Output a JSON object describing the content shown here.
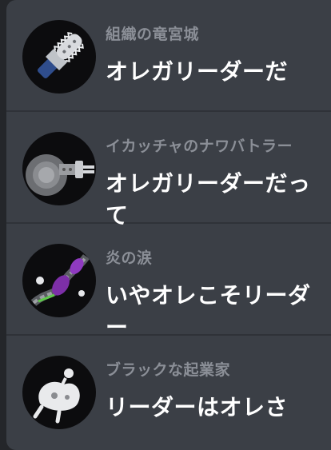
{
  "entries": [
    {
      "team": "組織の竜宮城",
      "title": "オレガリーダーだ",
      "icon": "chainsaw-icon"
    },
    {
      "team": "イカッチャのナワバトラー",
      "title": "オレガリーダーだって",
      "icon": "hand-drill-icon"
    },
    {
      "team": "炎の涙",
      "title": "いやオレこそリーダー",
      "icon": "purple-chain-icon"
    },
    {
      "team": "ブラックな起業家",
      "title": "リーダーはオレさ",
      "icon": "white-creature-icon"
    }
  ],
  "colors": {
    "background": "#24262a",
    "panel": "#3b3f46",
    "team_text": "#8b8f97",
    "title_text": "#ffffff"
  }
}
